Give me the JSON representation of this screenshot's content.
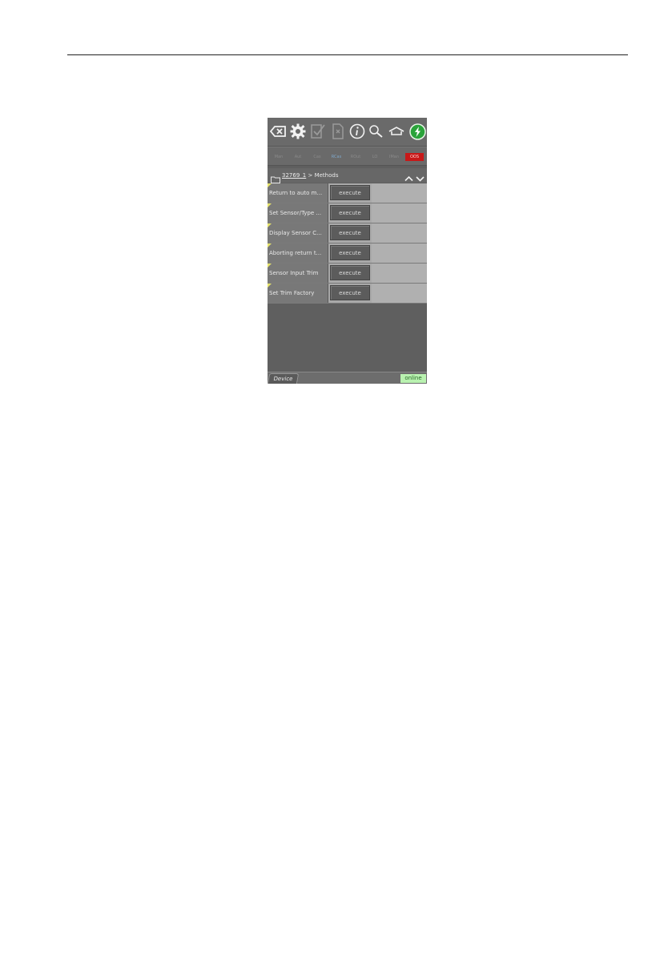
{
  "app": {
    "toolbar": {
      "icons": [
        "backspace-icon",
        "gear-icon",
        "checklist-icon",
        "document-icon",
        "info-icon",
        "search-icon",
        "home-icon",
        "power-connection-icon"
      ]
    },
    "modes": [
      {
        "label": "Man",
        "state": "inactive"
      },
      {
        "label": "Aut",
        "state": "inactive"
      },
      {
        "label": "Cas",
        "state": "inactive"
      },
      {
        "label": "RCas",
        "state": "active"
      },
      {
        "label": "ROut",
        "state": "inactive"
      },
      {
        "label": "LO",
        "state": "inactive"
      },
      {
        "label": "IMan",
        "state": "inactive"
      },
      {
        "label": "OOS",
        "state": "alarm"
      }
    ],
    "breadcrumb": {
      "device": "32769_1",
      "separator": " > ",
      "section": "Methods"
    },
    "methods": [
      {
        "label": "Return to auto m...",
        "button": "execute"
      },
      {
        "label": "Set Sensor/Type ...",
        "button": "execute"
      },
      {
        "label": "Display Sensor C...",
        "button": "execute"
      },
      {
        "label": "Aborting return t...",
        "button": "execute"
      },
      {
        "label": "Sensor Input Trim",
        "button": "execute"
      },
      {
        "label": "Set Trim Factory",
        "button": "execute"
      }
    ],
    "footer": {
      "tab": "Device",
      "status": "online"
    },
    "colors": {
      "oos": "#c81818",
      "online": "#b9f2b0",
      "power": "#2aa33a"
    }
  }
}
